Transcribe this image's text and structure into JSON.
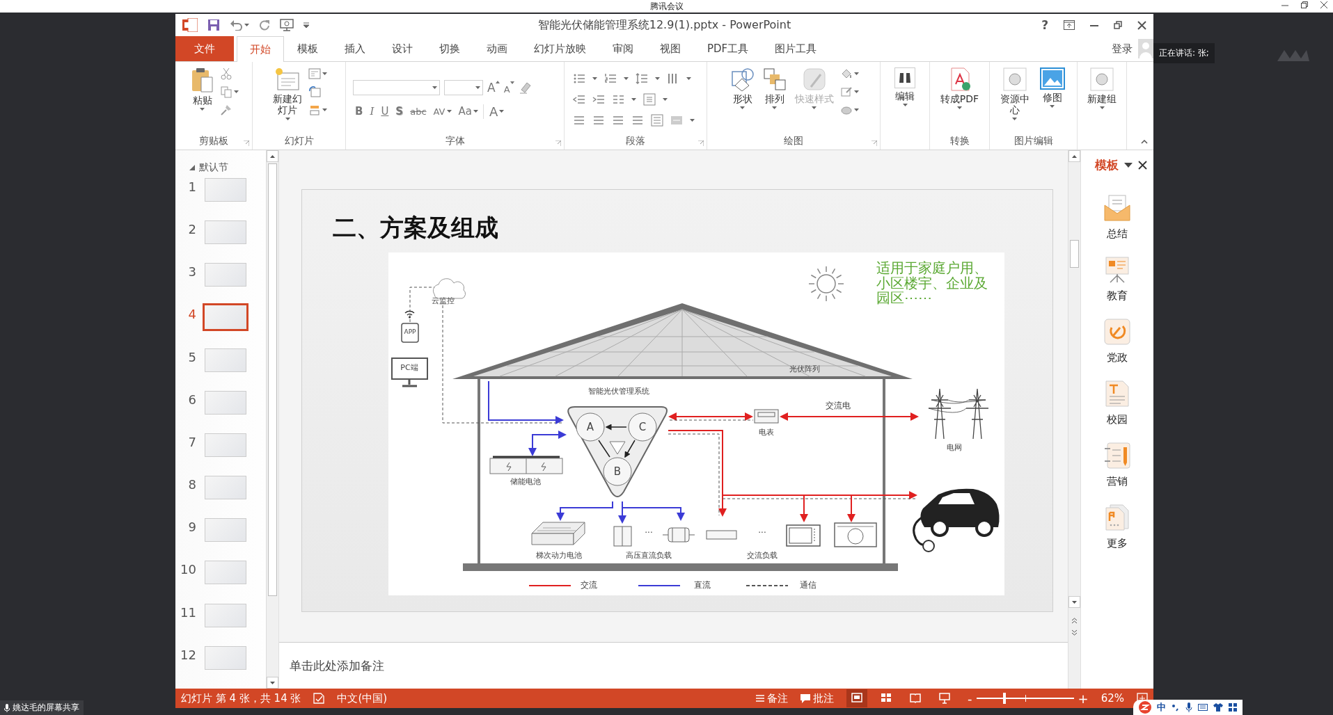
{
  "meeting": {
    "title": "腾讯会议",
    "speaker": "正在讲话: 张;",
    "share_label": "姚达毛的屏幕共享",
    "ime_label": "中"
  },
  "window": {
    "title": "智能光伏储能管理系统12.9(1).pptx - PowerPoint",
    "help": "?"
  },
  "tabs": [
    {
      "label": "文件",
      "kind": "file",
      "selected": false
    },
    {
      "label": "开始",
      "kind": "tab",
      "selected": true
    },
    {
      "label": "模板",
      "kind": "tab",
      "selected": false
    },
    {
      "label": "插入",
      "kind": "tab",
      "selected": false
    },
    {
      "label": "设计",
      "kind": "tab",
      "selected": false
    },
    {
      "label": "切换",
      "kind": "tab",
      "selected": false
    },
    {
      "label": "动画",
      "kind": "tab",
      "selected": false
    },
    {
      "label": "幻灯片放映",
      "kind": "tab",
      "selected": false
    },
    {
      "label": "审阅",
      "kind": "tab",
      "selected": false
    },
    {
      "label": "视图",
      "kind": "tab",
      "selected": false
    },
    {
      "label": "PDF工具",
      "kind": "tab",
      "selected": false
    },
    {
      "label": "图片工具",
      "kind": "tab",
      "selected": false
    }
  ],
  "account": {
    "label": "登录"
  },
  "ribbon": {
    "clipboard": {
      "caption": "剪贴板",
      "paste": "粘贴"
    },
    "slides": {
      "caption": "幻灯片",
      "new_slide": "新建幻灯片"
    },
    "font": {
      "caption": "字体",
      "grow": "A",
      "shrink": "A",
      "buttons": [
        {
          "label": "B",
          "kind": "bold"
        },
        {
          "label": "I",
          "kind": "italic"
        },
        {
          "label": "U",
          "kind": "underline"
        },
        {
          "label": "S",
          "kind": "shadow"
        },
        {
          "label": "abc",
          "kind": "strike"
        },
        {
          "label": "AV",
          "kind": "spacing"
        },
        {
          "label": "Aa",
          "kind": "case"
        },
        {
          "label": "A",
          "kind": "color"
        }
      ]
    },
    "paragraph": {
      "caption": "段落"
    },
    "drawing": {
      "caption": "绘图",
      "buttons": [
        {
          "label": "形状",
          "kind": "shapes",
          "disabled": false
        },
        {
          "label": "排列",
          "kind": "arrange",
          "disabled": false
        },
        {
          "label": "快速样式",
          "kind": "styles",
          "disabled": true
        }
      ]
    },
    "edit": {
      "label": "编辑"
    },
    "convert": {
      "caption": "转换",
      "label": "转成PDF"
    },
    "picture": {
      "caption": "图片编辑",
      "buttons": [
        {
          "label": "资源中心",
          "kind": "resource"
        },
        {
          "label": "修图",
          "kind": "retouch"
        }
      ]
    },
    "new_group": {
      "label": "新建组"
    }
  },
  "thumbnails": {
    "section": "默认节",
    "expanded": true,
    "slides": [
      {
        "number": "1",
        "selected": false
      },
      {
        "number": "2",
        "selected": false
      },
      {
        "number": "3",
        "selected": false
      },
      {
        "number": "4",
        "selected": true
      },
      {
        "number": "5",
        "selected": false
      },
      {
        "number": "6",
        "selected": false
      },
      {
        "number": "7",
        "selected": false
      },
      {
        "number": "8",
        "selected": false
      },
      {
        "number": "9",
        "selected": false
      },
      {
        "number": "10",
        "selected": false
      },
      {
        "number": "11",
        "selected": false
      },
      {
        "number": "12",
        "selected": false
      }
    ]
  },
  "slide": {
    "title": "二、方案及组成",
    "diagram": {
      "cloud": "云监控",
      "app": "APP",
      "pc": "PC端",
      "pv_array": "光伏阵列",
      "system": "智能光伏管理系统",
      "module_a": "A",
      "module_b": "B",
      "module_c": "C",
      "ac_power": "交流电",
      "meter": "电表",
      "grid": "电网",
      "storage": "储能电池",
      "second_life": "梯次动力电池",
      "dc_ellipsis": "···",
      "dc_loads": "高压直流负载",
      "ac_ellipsis": "···",
      "ac_loads": "交流负载",
      "scope_note": "适用于家庭户用、小区楼宇、企业及园区⋯⋯",
      "legend": [
        {
          "label": "交流",
          "kind": "ac"
        },
        {
          "label": "直流",
          "kind": "dc"
        },
        {
          "label": "通信",
          "kind": "comm"
        }
      ]
    }
  },
  "notes": {
    "prompt": "单击此处添加备注"
  },
  "template_pane": {
    "title": "模板",
    "items": [
      {
        "label": "总结",
        "kind": "envelope"
      },
      {
        "label": "教育",
        "kind": "easel"
      },
      {
        "label": "党政",
        "kind": "emblem"
      },
      {
        "label": "校园",
        "kind": "document"
      },
      {
        "label": "营销",
        "kind": "notebook"
      },
      {
        "label": "更多",
        "kind": "file"
      }
    ]
  },
  "status_bar": {
    "slide_info": "幻灯片 第 4 张，共 14 张",
    "language": "中文(中国)",
    "notes": "备注",
    "comments": "批注",
    "views": [
      {
        "kind": "normal",
        "selected": true
      },
      {
        "kind": "sorter",
        "selected": false
      },
      {
        "kind": "reading",
        "selected": false
      },
      {
        "kind": "slideshow",
        "selected": false
      }
    ],
    "zoom_minus": "-",
    "zoom_plus": "+",
    "zoom": {
      "level": 0.29
    },
    "zoom_label": "62%"
  }
}
